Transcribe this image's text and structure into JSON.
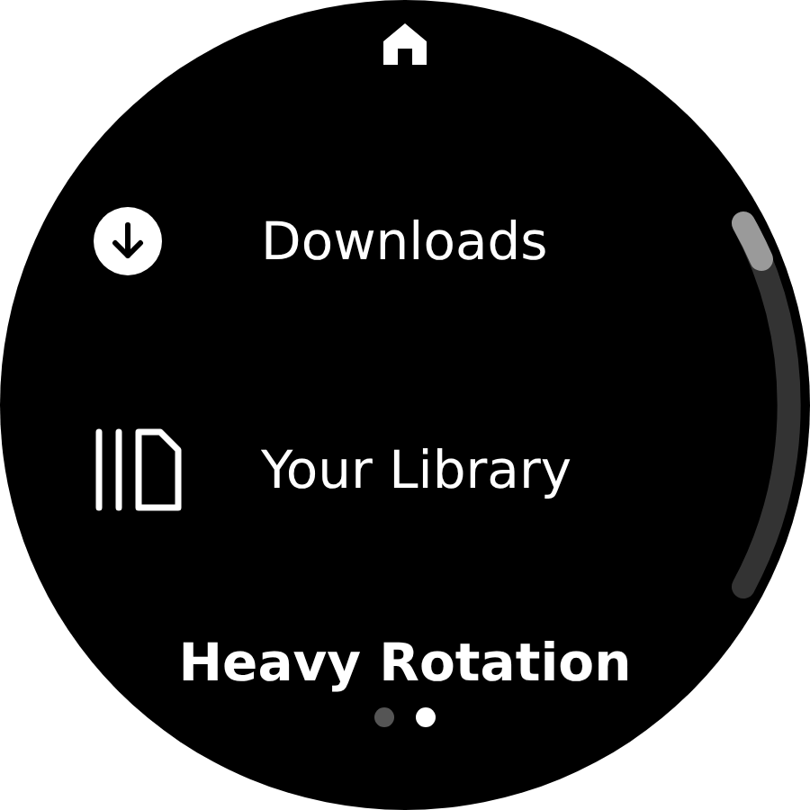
{
  "menu_items": [
    {
      "label": "Downloads",
      "kind": "download"
    },
    {
      "label": "Your Library",
      "kind": "library"
    }
  ],
  "section_heading": "Heavy Rotation",
  "page_dots": [
    {
      "selected": false
    },
    {
      "selected": true
    }
  ]
}
